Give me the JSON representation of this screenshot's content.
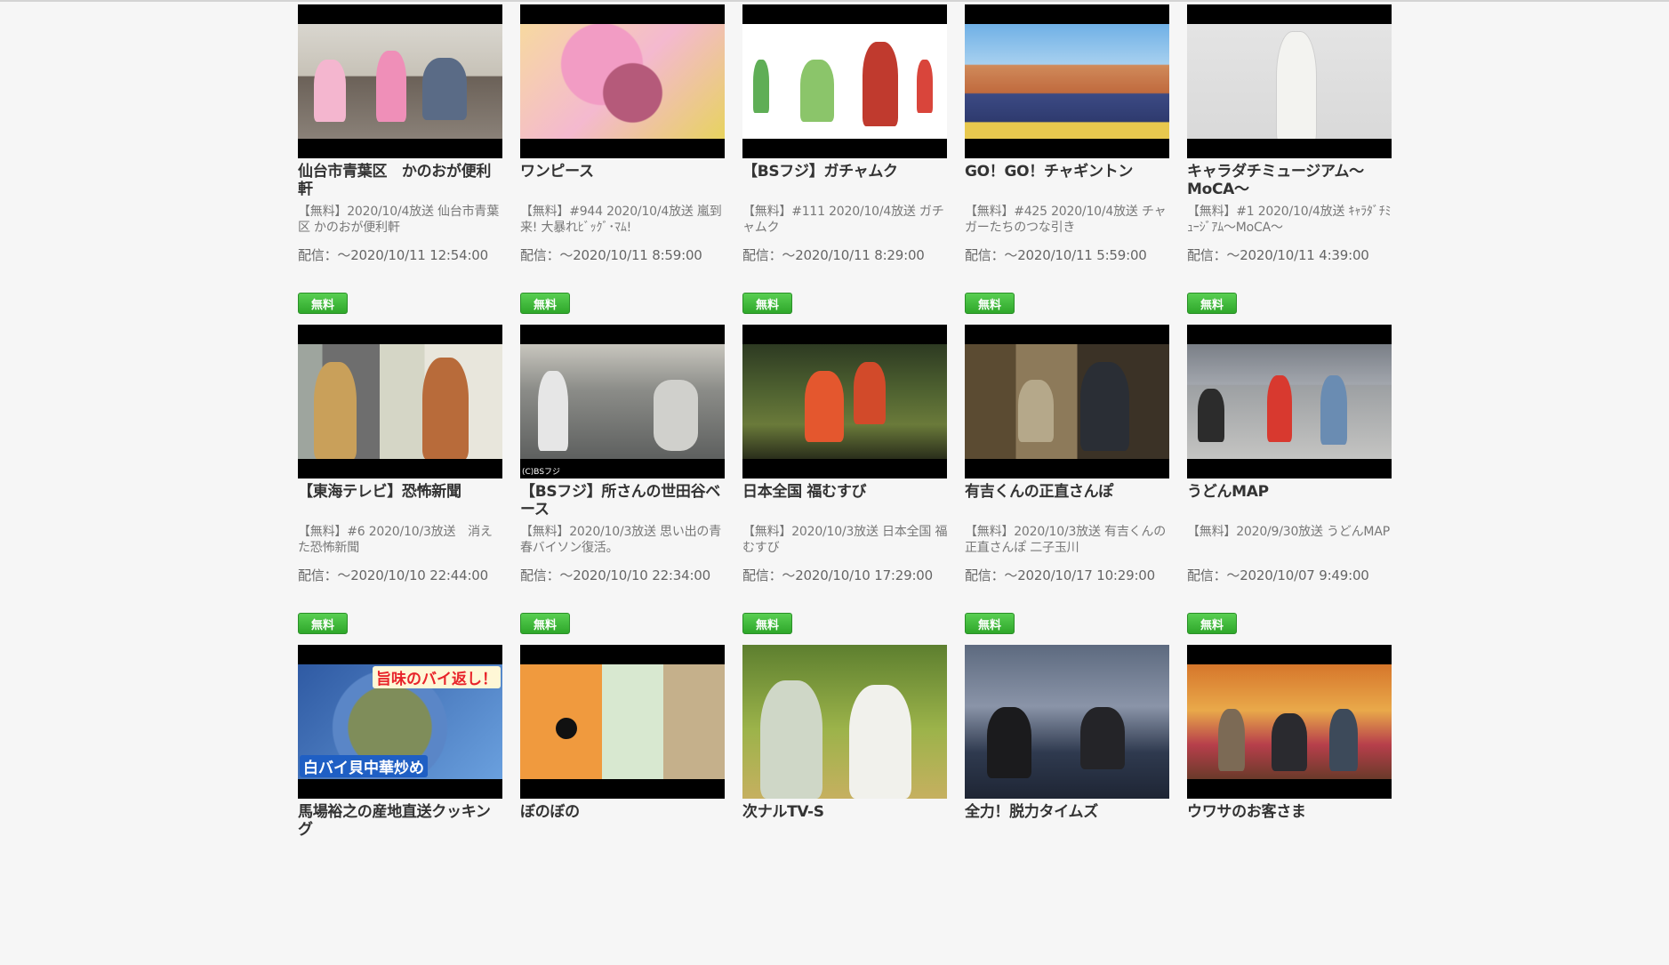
{
  "badge_label": "無料",
  "programs": [
    {
      "title": "仙台市青葉区　かのおが便利軒",
      "description": "【無料】2020/10/4放送 仙台市青葉区 かのおが便利軒",
      "availability": "配信：～2020/10/11 12:54:00",
      "thumbnail": "office-icon"
    },
    {
      "title": "ワンピース",
      "description": "【無料】#944 2020/10/4放送 嵐到来! 大暴れﾋﾞｯｸﾞ･ﾏﾑ!",
      "availability": "配信：～2020/10/11 8:59:00",
      "thumbnail": "anime-icon"
    },
    {
      "title": "【BSフジ】ガチャムク",
      "description": "【無料】#111 2020/10/4放送 ガチャムク",
      "availability": "配信：～2020/10/11 8:29:00",
      "thumbnail": "puppet-icon"
    },
    {
      "title": "GO！GO！チャギントン",
      "description": "【無料】#425 2020/10/4放送 チャガーたちのつな引き",
      "availability": "配信：～2020/10/11 5:59:00",
      "thumbnail": "train-icon"
    },
    {
      "title": "キャラダチミュージアム～MoCA～",
      "description": "【無料】#1 2020/10/4放送 ｷｬﾗﾀﾞﾁﾐｭｰｼﾞｱﾑ～MoCA～",
      "availability": "配信：～2020/10/11 4:39:00",
      "thumbnail": "woman-icon"
    },
    {
      "title": "【東海テレビ】恐怖新聞",
      "description": "【無料】#6 2020/10/3放送　消えた恐怖新聞",
      "availability": "配信：～2020/10/10 22:44:00",
      "thumbnail": "drama-icon"
    },
    {
      "title": "【BSフジ】所さんの世田谷ベース",
      "description": "【無料】2020/10/3放送 思い出の青春バイソン復活。",
      "availability": "配信：～2020/10/10 22:34:00",
      "thumbnail": "garage-icon",
      "credit": "(C)BSフジ"
    },
    {
      "title": "日本全国 福むすび",
      "description": "【無料】2020/10/3放送 日本全国 福むすび",
      "availability": "配信：～2020/10/10 17:29:00",
      "thumbnail": "forest-icon"
    },
    {
      "title": "有吉くんの正直さんぽ",
      "description": "【無料】2020/10/3放送 有吉くんの正直さんぽ 二子玉川",
      "availability": "配信：～2020/10/17 10:29:00",
      "thumbnail": "terrace-icon"
    },
    {
      "title": "うどんMAP",
      "description": "【無料】2020/9/30放送 うどんMAP",
      "availability": "配信：～2020/10/07 9:49:00",
      "thumbnail": "street-icon"
    },
    {
      "title": "馬場裕之の産地直送クッキング",
      "description": "",
      "availability": "",
      "thumbnail": "food-icon",
      "overlay_top": "旨味のバイ返し！",
      "overlay_bottom": "白バイ貝中華炒め"
    },
    {
      "title": "ぼのぼの",
      "description": "",
      "availability": "",
      "thumbnail": "cartoon-icon"
    },
    {
      "title": "次ナルTV-S",
      "description": "",
      "availability": "",
      "thumbnail": "garden-icon"
    },
    {
      "title": "全力！脱力タイムズ",
      "description": "",
      "availability": "",
      "thumbnail": "studio-icon"
    },
    {
      "title": "ウワサのお客さま",
      "description": "",
      "availability": "",
      "thumbnail": "stage-icon"
    }
  ]
}
